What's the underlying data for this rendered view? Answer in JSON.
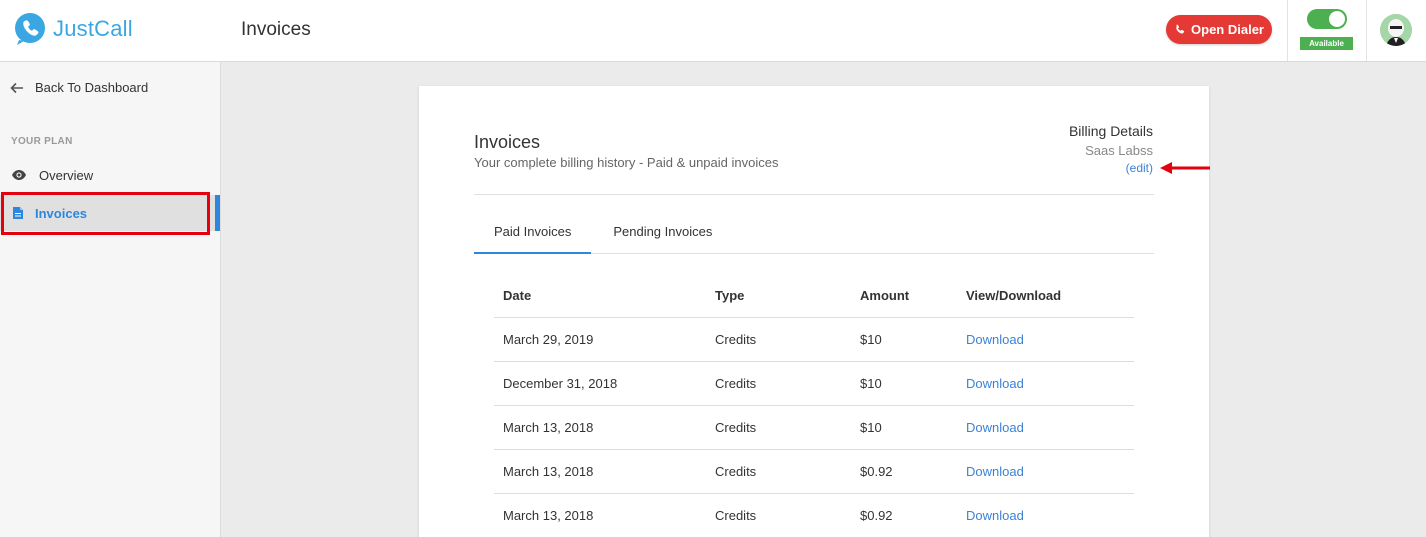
{
  "header": {
    "brand": "JustCall",
    "title": "Invoices",
    "dialer_label": "Open Dialer",
    "status_label": "Available",
    "status_color": "#4caf50",
    "accent_red": "#e53935"
  },
  "sidebar": {
    "back_label": "Back To Dashboard",
    "section_label": "YOUR PLAN",
    "items": [
      {
        "label": "Overview",
        "icon": "eye-icon"
      },
      {
        "label": "Invoices",
        "icon": "document-icon",
        "active": true
      }
    ],
    "accent": "#2e86de"
  },
  "card": {
    "title": "Invoices",
    "subtitle": "Your complete billing history - Paid & unpaid invoices",
    "billing": {
      "title": "Billing Details",
      "company": "Saas Labss",
      "edit_label": "(edit)"
    },
    "tabs": [
      {
        "label": "Paid Invoices",
        "active": true
      },
      {
        "label": "Pending Invoices",
        "active": false
      }
    ],
    "table": {
      "headers": [
        "Date",
        "Type",
        "Amount",
        "View/Download"
      ],
      "rows": [
        {
          "date": "March 29, 2019",
          "type": "Credits",
          "amount": "$10",
          "action": "Download"
        },
        {
          "date": "December 31, 2018",
          "type": "Credits",
          "amount": "$10",
          "action": "Download"
        },
        {
          "date": "March 13, 2018",
          "type": "Credits",
          "amount": "$10",
          "action": "Download"
        },
        {
          "date": "March 13, 2018",
          "type": "Credits",
          "amount": "$0.92",
          "action": "Download"
        },
        {
          "date": "March 13, 2018",
          "type": "Credits",
          "amount": "$0.92",
          "action": "Download"
        }
      ]
    }
  }
}
